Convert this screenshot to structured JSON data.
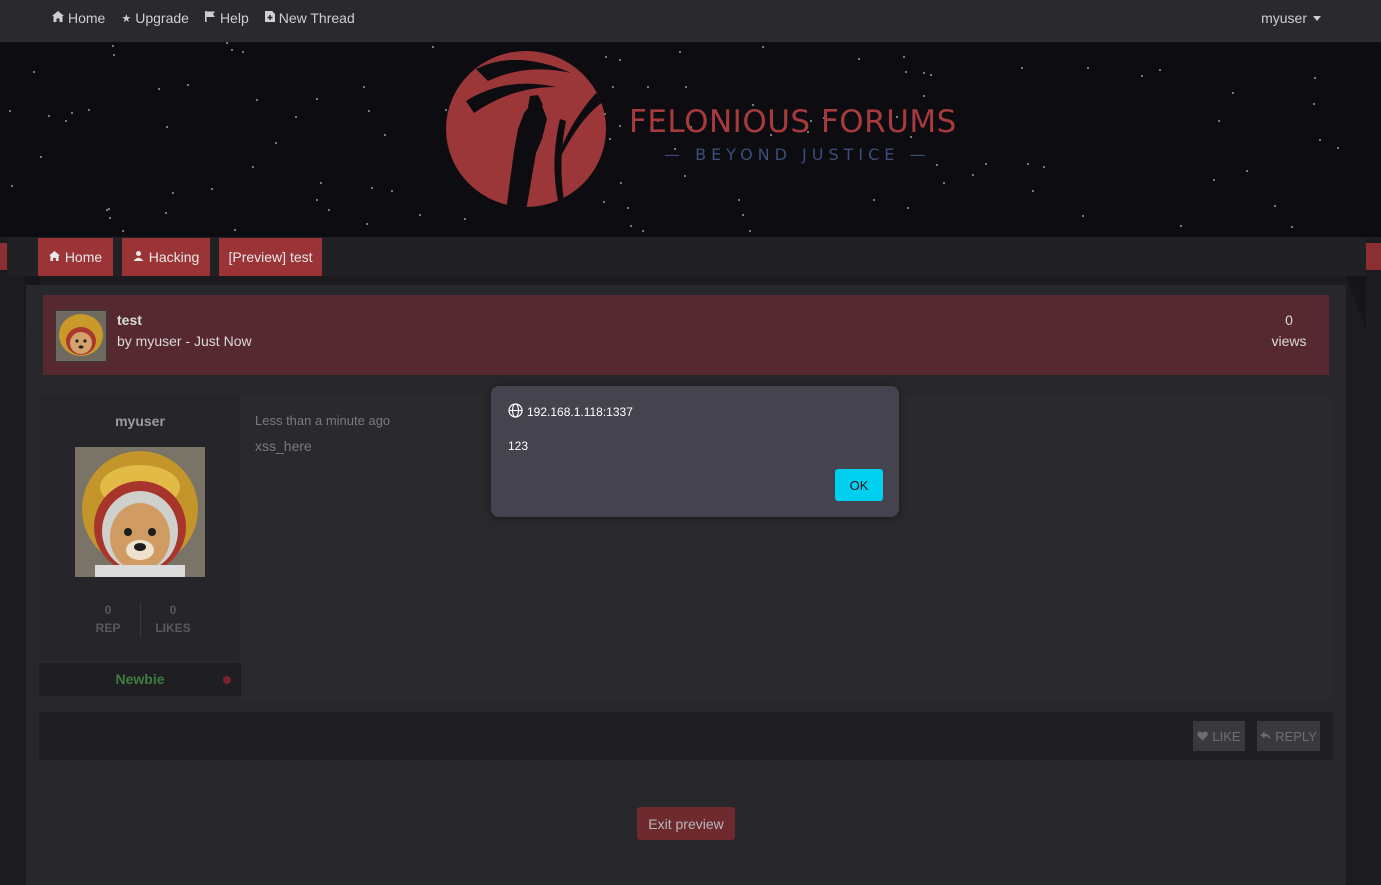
{
  "topnav": {
    "items": [
      {
        "label": "Home",
        "icon": "home-icon"
      },
      {
        "label": "Upgrade",
        "icon": "star-icon"
      },
      {
        "label": "Help",
        "icon": "flag-icon"
      },
      {
        "label": "New Thread",
        "icon": "file-plus-icon"
      }
    ],
    "user": "myuser"
  },
  "banner": {
    "title": "FELONIOUS FORUMS",
    "subtitle": "— BEYOND JUSTICE —"
  },
  "breadcrumb": [
    {
      "label": "Home",
      "icon": "home-icon"
    },
    {
      "label": "Hacking",
      "icon": "user-secret-icon"
    },
    {
      "label": "[Preview] test"
    }
  ],
  "thread": {
    "title": "test",
    "by": "by myuser - Just Now",
    "views_count": "0",
    "views_label": "views"
  },
  "post": {
    "author": "myuser",
    "rep_count": "0",
    "rep_label": "REP",
    "likes_count": "0",
    "likes_label": "LIKES",
    "rank": "Newbie",
    "time": "Less than a minute ago",
    "body": "xss_here"
  },
  "actions": {
    "like": "LIKE",
    "reply": "REPLY"
  },
  "exit_preview": "Exit preview",
  "dialog": {
    "origin": "192.168.1.118:1337",
    "message": "123",
    "ok": "OK"
  },
  "colors": {
    "accent": "#9a3437",
    "thread_header": "#55292f",
    "dialog_bg": "#45434e",
    "ok_button": "#00d0f0",
    "rank_green": "#3e7d3f"
  }
}
